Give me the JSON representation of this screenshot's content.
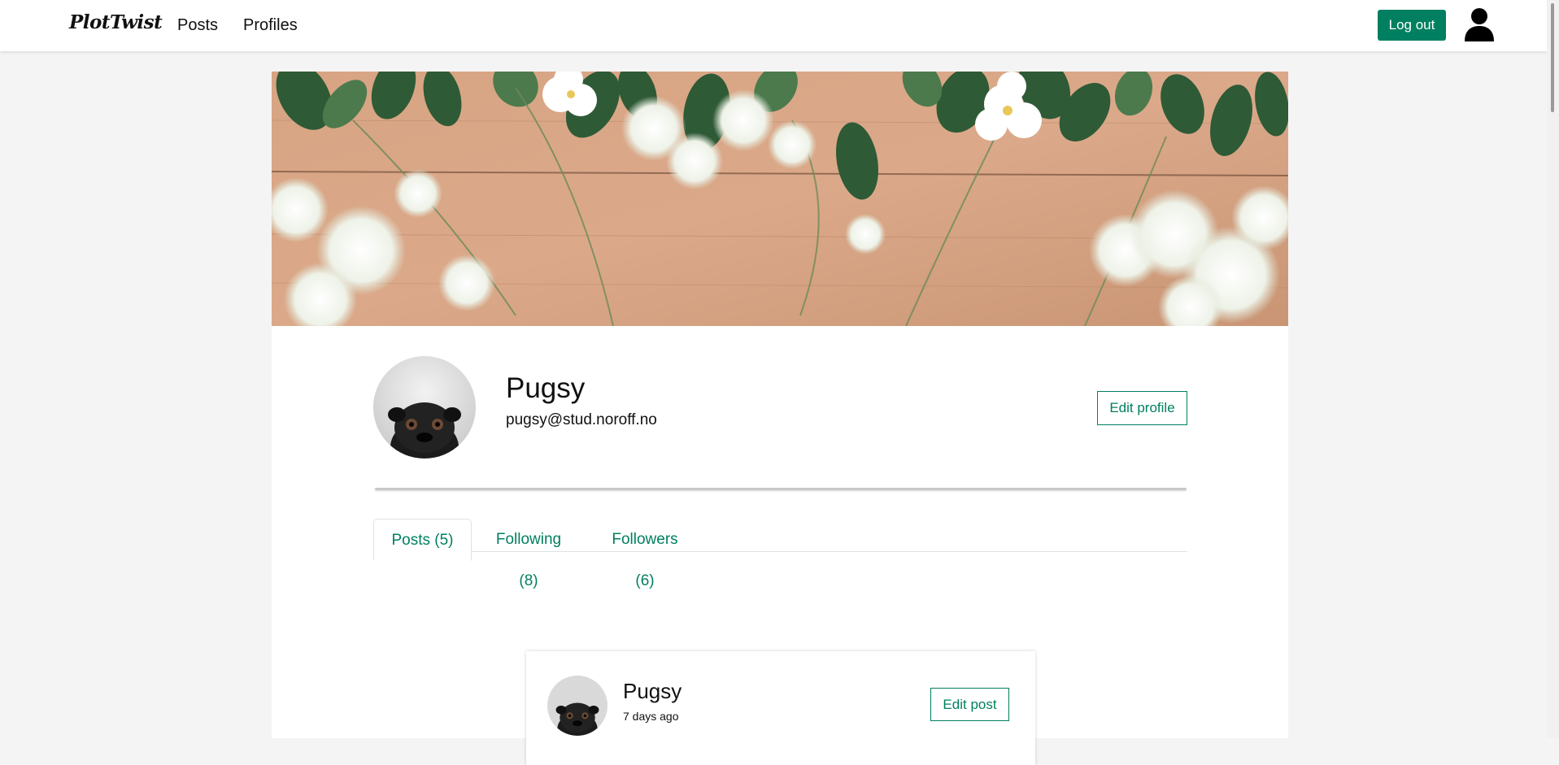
{
  "navbar": {
    "brand": "PlotTwist",
    "links": [
      {
        "label": "Posts"
      },
      {
        "label": "Profiles"
      }
    ],
    "logout_label": "Log out",
    "user_icon": "user-silhouette-icon"
  },
  "profile": {
    "name": "Pugsy",
    "email": "pugsy@stud.noroff.no",
    "edit_label": "Edit profile",
    "banner": "flowers-on-wood-banner",
    "avatar": "pug-avatar"
  },
  "tabs": [
    {
      "label": "Posts (5)",
      "active": true
    },
    {
      "label": "Following (8)",
      "active": false
    },
    {
      "label": "Followers (6)",
      "active": false
    }
  ],
  "posts": [
    {
      "author": "Pugsy",
      "time": "7 days ago",
      "edit_label": "Edit post"
    }
  ],
  "colors": {
    "accent": "#008060",
    "page_background": "#f4f4f4",
    "surface": "#ffffff"
  }
}
